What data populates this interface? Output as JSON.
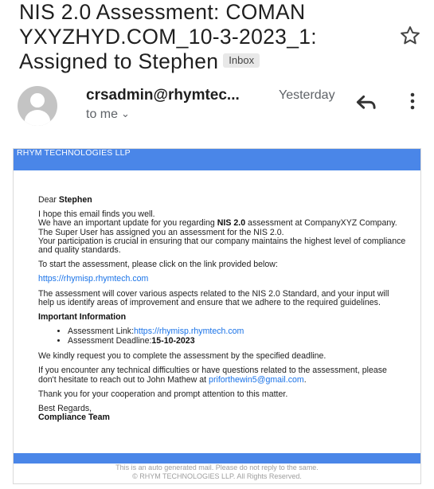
{
  "email": {
    "subject": "NIS 2.0 Assessment: COMAN YXYZHYD.COM_10-3-2023_1: Assigned to Stephen",
    "label": "Inbox",
    "sender": "crsadmin@rhymtec...",
    "date": "Yesterday",
    "recipient": "to me"
  },
  "body": {
    "banner": "RHYM TECHNOLOGIES LLP",
    "greeting": "Dear ",
    "recipient_name": "Stephen",
    "intro1": "I hope this email finds you well.",
    "intro2a": "We have an important update for you regarding ",
    "intro2_bold": "NIS 2.0",
    "intro2b": " assessment at CompanyXYZ Company.",
    "intro3": "The Super User has assigned you an assessment for the NIS 2.0.",
    "intro4": "Your participation is crucial in ensuring that our company maintains the highest level of compliance and quality standards.",
    "start_text": "To start the assessment, please click on the link provided below:",
    "link": "https://rhymisp.rhymtech.com",
    "coverage": "The assessment will cover various aspects related to the NIS 2.0 Standard, and your input will help us identify areas of improvement and ensure that we adhere to the required guidelines.",
    "important_heading": "Important Information",
    "link_label": "Assessment Link:",
    "deadline_label": "Assessment Deadline:",
    "deadline": "15-10-2023",
    "request": "We kindly request you to complete the assessment by the specified deadline.",
    "help_text": "If you encounter any technical difficulties or have questions related to the assessment, please don't hesitate to reach out to John Mathew at",
    "help_email": "priforthewin5@gmail.com",
    "help_end": ".",
    "thanks": "Thank you for your cooperation and prompt attention to this matter.",
    "regards": "Best Regards,",
    "team": "Compliance Team"
  },
  "footer": {
    "auto_note": "This is an auto generated mail. Please do not reply to the same.",
    "copyright": "© RHYM TECHNOLOGIES LLP. All Rights Reserved."
  },
  "colors": {
    "banner_blue": "#4a86e8",
    "link_blue": "#1a73e8"
  },
  "icons": {
    "star": "star-icon",
    "reply": "reply-icon",
    "more": "more-vert-icon",
    "avatar": "person-avatar-icon",
    "chevron": "chevron-down-icon"
  }
}
